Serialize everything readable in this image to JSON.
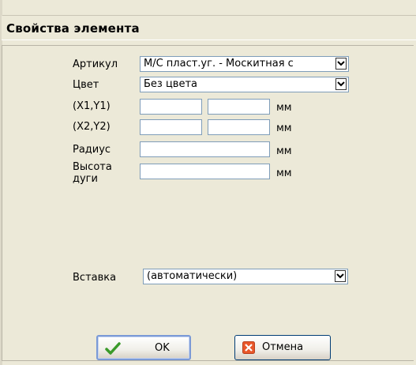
{
  "dialog": {
    "title": "Свойства элемента"
  },
  "fields": {
    "article": {
      "label": "Артикул",
      "value": "М/С пласт.уг. - Москитная с"
    },
    "color": {
      "label": "Цвет",
      "value": "Без цвета"
    },
    "xy1": {
      "label": "(X1,Y1)",
      "x": "",
      "y": "",
      "unit": "мм"
    },
    "xy2": {
      "label": "(X2,Y2)",
      "x": "",
      "y": "",
      "unit": "мм"
    },
    "radius": {
      "label": "Радиус",
      "value": "",
      "unit": "мм"
    },
    "arc": {
      "label_line1": "Высота",
      "label_line2": "дуги",
      "value": "",
      "unit": "мм"
    },
    "insert": {
      "label": "Вставка",
      "value": "(автоматически)"
    }
  },
  "buttons": {
    "ok": {
      "label": "OK",
      "icon": "check-icon",
      "color": "#3a9a2a"
    },
    "cancel": {
      "label": "Отмена",
      "icon": "close-icon",
      "color": "#e8572a"
    }
  }
}
